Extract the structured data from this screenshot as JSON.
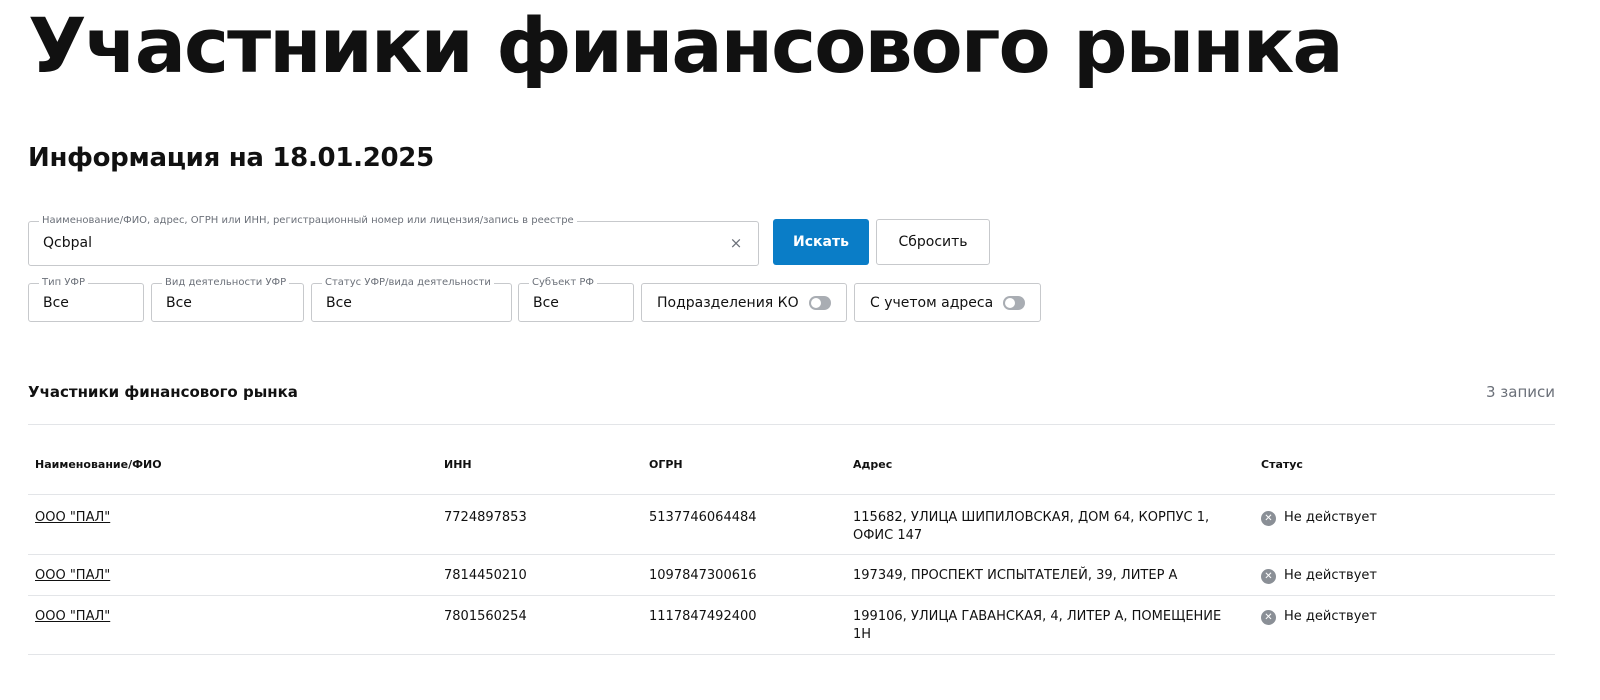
{
  "page": {
    "title": "Участники финансового рынка",
    "info_heading": "Информация на 18.01.2025"
  },
  "search": {
    "legend": "Наименование/ФИО, адрес, ОГРН или ИНН, регистрационный номер или лицензия/запись в реестре",
    "value": "Qcbpal",
    "clear_icon": "×",
    "search_label": "Искать",
    "reset_label": "Сбросить"
  },
  "filters": {
    "type": {
      "legend": "Тип УФР",
      "value": "Все"
    },
    "activity": {
      "legend": "Вид деятельности УФР",
      "value": "Все"
    },
    "status": {
      "legend": "Статус УФР/вида деятельности",
      "value": "Все"
    },
    "region": {
      "legend": "Субъект РФ",
      "value": "Все"
    },
    "toggle_ko": {
      "label": "Подразделения КО",
      "on": false
    },
    "toggle_address": {
      "label": "С учетом адреса",
      "on": false
    }
  },
  "results": {
    "title": "Участники финансового рынка",
    "count": "3 записи",
    "columns": {
      "name": "Наименование/ФИО",
      "inn": "ИНН",
      "ogrn": "ОГРН",
      "address": "Адрес",
      "status": "Статус"
    },
    "rows": [
      {
        "name": "ООО \"ПАЛ\"",
        "inn": "7724897853",
        "ogrn": "5137746064484",
        "address": "115682, УЛИЦА ШИПИЛОВСКАЯ, ДОМ 64, КОРПУС 1, ОФИС 147",
        "status": "Не действует"
      },
      {
        "name": "ООО \"ПАЛ\"",
        "inn": "7814450210",
        "ogrn": "1097847300616",
        "address": "197349, ПРОСПЕКТ ИСПЫТАТЕЛЕЙ, 39, ЛИТЕР А",
        "status": "Не действует"
      },
      {
        "name": "ООО \"ПАЛ\"",
        "inn": "7801560254",
        "ogrn": "1117847492400",
        "address": "199106, УЛИЦА ГАВАНСКАЯ, 4, ЛИТЕР А, ПОМЕЩЕНИЕ 1Н",
        "status": "Не действует"
      }
    ]
  },
  "colors": {
    "primary": "#0a7dc7",
    "status_inactive": "#8a8f96",
    "border": "#c7c9cc"
  }
}
